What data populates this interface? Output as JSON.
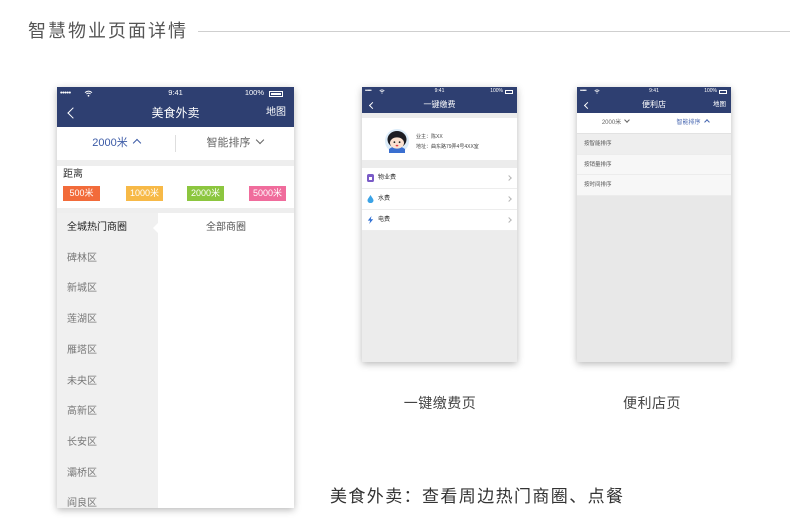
{
  "page_title": "智慧物业页面详情",
  "theme": {
    "nav_color": "#2e3f71",
    "accent": "#3b5aa6"
  },
  "food": {
    "status": {
      "signal": "•••••",
      "time": "9:41",
      "battery": "100%"
    },
    "nav": {
      "title": "美食外卖",
      "right": "地图"
    },
    "filter": {
      "distance": "2000米",
      "sort": "智能排序"
    },
    "distance_label": "距离",
    "chips": [
      {
        "label": "500米",
        "color": "#f26b3a"
      },
      {
        "label": "1000米",
        "color": "#f7b947"
      },
      {
        "label": "2000米",
        "color": "#8cc63f"
      },
      {
        "label": "5000米",
        "color": "#f06c9c"
      }
    ],
    "districts": [
      "全城热门商圈",
      "碑林区",
      "新城区",
      "莲湖区",
      "雁塔区",
      "未央区",
      "高新区",
      "长安区",
      "灞桥区",
      "阎良区"
    ],
    "sub_areas": [
      "全部商圈"
    ]
  },
  "pay": {
    "status": {
      "signal": "•••••",
      "time": "9:41",
      "battery": "100%"
    },
    "nav": {
      "title": "一键缴费"
    },
    "owner": {
      "name_line": "业主：陈XX",
      "address_line": "地址：曲东路79弄4号4XX室"
    },
    "items": [
      {
        "label": "物业费",
        "icon": "property-fee-icon",
        "icon_color": "#7a5bc7"
      },
      {
        "label": "水费",
        "icon": "water-drop-icon",
        "icon_color": "#3ba3e6"
      },
      {
        "label": "电费",
        "icon": "lightning-icon",
        "icon_color": "#2f6fd3"
      }
    ]
  },
  "store": {
    "status": {
      "signal": "•••••",
      "time": "9:41",
      "battery": "100%"
    },
    "nav": {
      "title": "便利店",
      "right": "地图"
    },
    "filter": {
      "distance": "2000米",
      "sort": "智能排序"
    },
    "sort_options": [
      "按智能排序",
      "按销量排序",
      "按时间排序"
    ]
  },
  "captions": {
    "pay": "一键缴费页",
    "store": "便利店页",
    "food": "美食外卖：查看周边热门商圈、点餐"
  }
}
